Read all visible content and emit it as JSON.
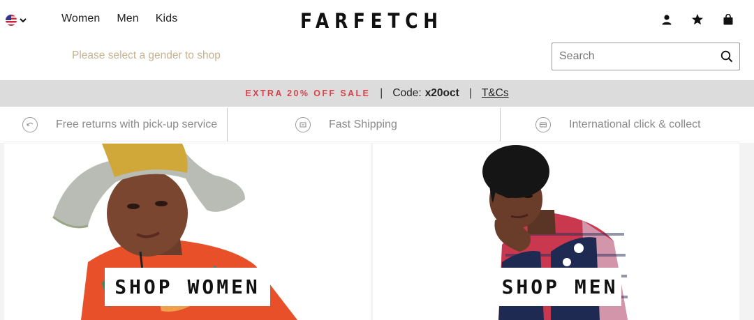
{
  "header": {
    "locale_icon": "us-flag-icon",
    "nav": [
      "Women",
      "Men",
      "Kids"
    ],
    "logo": "FARFETCH",
    "icons": [
      "account-icon",
      "wishlist-star-icon",
      "bag-icon"
    ],
    "gender_prompt": "Please select a gender to shop",
    "search": {
      "placeholder": "Search",
      "value": ""
    }
  },
  "promo": {
    "sale_text": "EXTRA 20% OFF SALE",
    "code_label": "Code:",
    "code_value": "x20oct",
    "terms_link": "T&Cs",
    "sale_color": "#d9434c"
  },
  "usps": [
    {
      "icon": "returns-icon",
      "label": "Free returns with pick-up service"
    },
    {
      "icon": "shipping-icon",
      "label": "Fast Shipping"
    },
    {
      "icon": "click-collect-icon",
      "label": "International click & collect"
    }
  ],
  "tiles": {
    "women": {
      "cta": "SHOP WOMEN"
    },
    "men": {
      "cta": "SHOP MEN"
    }
  }
}
